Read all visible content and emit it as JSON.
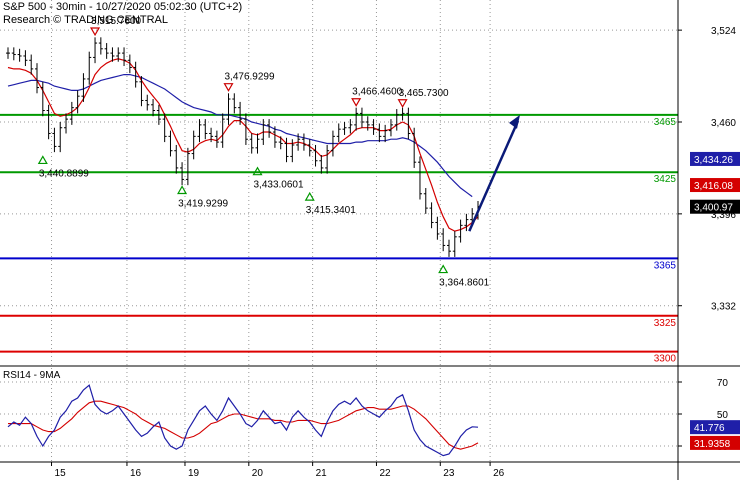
{
  "header": {
    "line1": "S&P 500 - 30min - 10/27/2020 05:02:30 (UTC+2)",
    "line2": "Research © TRADING CENTRAL"
  },
  "colors": {
    "price": "#000000",
    "ma_fast": "#d40000",
    "ma_slow": "#1f1fa8",
    "support_resistance": "#009900",
    "pivot": "#0000cc",
    "lower_levels": "#dd0000",
    "arrow": "#0a1a78",
    "grid": "#999999"
  },
  "chart_data": [
    {
      "type": "line",
      "title": "S&P 500 - 30min - 10/27/2020 05:02:30 (UTC+2)",
      "x_tick_labels": [
        "15",
        "16",
        "19",
        "20",
        "21",
        "22",
        "23",
        "26"
      ],
      "y_tick_labels": [
        "3,524",
        "3,460",
        "3,396",
        "3,332"
      ],
      "ylim": [
        3290,
        3545
      ],
      "grid": true,
      "current_price": "3,400.97",
      "indicator_values": [
        "3,434.26",
        "3,416.08"
      ],
      "indicator_values_numeric": [
        3434.26,
        3416.08
      ],
      "current_price_numeric": 3400.97,
      "price": [
        3508,
        3507,
        3506,
        3503,
        3497,
        3484,
        3468,
        3452,
        3443,
        3456,
        3462,
        3470,
        3478,
        3490,
        3505,
        3515,
        3511,
        3508,
        3506,
        3508,
        3503,
        3498,
        3488,
        3475,
        3472,
        3468,
        3462,
        3450,
        3440,
        3428,
        3420,
        3438,
        3450,
        3458,
        3452,
        3450,
        3446,
        3462,
        3476,
        3470,
        3462,
        3448,
        3442,
        3448,
        3458,
        3453,
        3446,
        3445,
        3436,
        3444,
        3448,
        3444,
        3440,
        3433,
        3428,
        3440,
        3450,
        3455,
        3456,
        3458,
        3466,
        3460,
        3458,
        3455,
        3450,
        3454,
        3458,
        3465,
        3466,
        3452,
        3432,
        3410,
        3400,
        3390,
        3382,
        3374,
        3370,
        3380,
        3388,
        3392,
        3396,
        3401
      ],
      "series": [
        {
          "name": "",
          "values": [
            3498,
            3497,
            3497,
            3496,
            3494,
            3489,
            3482,
            3474,
            3466,
            3464,
            3465,
            3467,
            3470,
            3476,
            3484,
            3493,
            3498,
            3501,
            3503,
            3504,
            3503,
            3501,
            3496,
            3489,
            3483,
            3478,
            3473,
            3465,
            3457,
            3448,
            3440,
            3439,
            3441,
            3445,
            3447,
            3448,
            3447,
            3451,
            3457,
            3461,
            3461,
            3457,
            3452,
            3451,
            3453,
            3453,
            3451,
            3449,
            3445,
            3445,
            3446,
            3445,
            3443,
            3440,
            3436,
            3437,
            3441,
            3445,
            3448,
            3451,
            3455,
            3456,
            3456,
            3456,
            3454,
            3454,
            3455,
            3458,
            3460,
            3458,
            3450,
            3438,
            3427,
            3416,
            3404,
            3394,
            3386,
            3384,
            3385,
            3387,
            3390,
            3394
          ]
        },
        {
          "name": "",
          "values": [
            3485,
            3486,
            3487,
            3488,
            3489,
            3489,
            3488,
            3487,
            3485,
            3484,
            3483,
            3482,
            3482,
            3483,
            3485,
            3487,
            3489,
            3490,
            3491,
            3492,
            3493,
            3493,
            3492,
            3491,
            3489,
            3487,
            3485,
            3483,
            3480,
            3477,
            3474,
            3472,
            3470,
            3469,
            3468,
            3467,
            3465,
            3465,
            3465,
            3464,
            3463,
            3462,
            3460,
            3459,
            3458,
            3457,
            3455,
            3454,
            3452,
            3451,
            3450,
            3449,
            3448,
            3447,
            3446,
            3445,
            3445,
            3445,
            3445,
            3445,
            3446,
            3446,
            3447,
            3447,
            3447,
            3447,
            3448,
            3448,
            3449,
            3448,
            3446,
            3443,
            3440,
            3436,
            3432,
            3427,
            3422,
            3418,
            3414,
            3411,
            3408,
            3434
          ]
        }
      ],
      "annotations": [
        {
          "label": "3,515.7600",
          "value": 3515.76,
          "x_index": 15,
          "type": "high"
        },
        {
          "label": "3,476.9299",
          "value": 3476.93,
          "x_index": 38,
          "type": "high"
        },
        {
          "label": "3,466.4600",
          "value": 3466.46,
          "x_index": 60,
          "type": "high"
        },
        {
          "label": "3,465.7300",
          "value": 3465.73,
          "x_index": 68,
          "type": "high"
        },
        {
          "label": "3,440.8899",
          "value": 3440.89,
          "x_index": 6,
          "type": "low"
        },
        {
          "label": "3,419.9299",
          "value": 3419.93,
          "x_index": 30,
          "type": "low"
        },
        {
          "label": "3,433.0601",
          "value": 3433.06,
          "x_index": 43,
          "type": "low"
        },
        {
          "label": "3,415.3401",
          "value": 3415.34,
          "x_index": 52,
          "type": "low"
        },
        {
          "label": "3,364.8601",
          "value": 3364.86,
          "x_index": 75,
          "type": "low"
        }
      ],
      "levels": [
        {
          "label": "3465",
          "value": 3465,
          "kind": "resistance"
        },
        {
          "label": "3425",
          "value": 3425,
          "kind": "resistance"
        },
        {
          "label": "3365",
          "value": 3365,
          "kind": "pivot"
        },
        {
          "label": "3325",
          "value": 3325,
          "kind": "support"
        },
        {
          "label": "3300",
          "value": 3300,
          "kind": "support"
        }
      ],
      "projection": {
        "from_index": 79,
        "to_value": 3465,
        "direction": "up"
      }
    },
    {
      "type": "line",
      "title": "RSI14 - 9MA",
      "x_tick_labels": [
        "15",
        "16",
        "19",
        "20",
        "21",
        "22",
        "23",
        "26"
      ],
      "y_tick_labels": [
        "70",
        "50",
        "30"
      ],
      "ylim": [
        20,
        80
      ],
      "grid": true,
      "current_values": [
        "41.776",
        "31.9358"
      ],
      "current_values_numeric": [
        41.776,
        31.9358
      ],
      "series": [
        {
          "name": "",
          "values": [
            42,
            45,
            43,
            48,
            44,
            36,
            30,
            36,
            40,
            48,
            52,
            58,
            60,
            65,
            68,
            56,
            52,
            50,
            52,
            55,
            50,
            45,
            40,
            36,
            38,
            42,
            45,
            35,
            30,
            28,
            30,
            40,
            46,
            52,
            55,
            50,
            46,
            52,
            60,
            55,
            50,
            44,
            42,
            46,
            52,
            48,
            44,
            45,
            40,
            48,
            52,
            48,
            45,
            40,
            36,
            45,
            52,
            56,
            58,
            56,
            60,
            55,
            52,
            50,
            48,
            52,
            55,
            60,
            62,
            52,
            40,
            34,
            30,
            28,
            26,
            24,
            25,
            30,
            36,
            40,
            42,
            41.776
          ]
        },
        {
          "name": "",
          "values": [
            44,
            44,
            44,
            44,
            44,
            42,
            40,
            39,
            39,
            41,
            44,
            47,
            51,
            54,
            57,
            58,
            58,
            57,
            56,
            55,
            54,
            52,
            50,
            47,
            45,
            43,
            42,
            41,
            39,
            37,
            35,
            35,
            36,
            38,
            41,
            44,
            45,
            47,
            49,
            50,
            50,
            49,
            48,
            47,
            47,
            47,
            46,
            46,
            45,
            45,
            46,
            46,
            46,
            45,
            44,
            44,
            45,
            46,
            48,
            50,
            52,
            53,
            54,
            54,
            53,
            53,
            53,
            54,
            55,
            55,
            53,
            50,
            47,
            43,
            39,
            35,
            31,
            29,
            28,
            29,
            30,
            31.9358
          ]
        }
      ],
      "levels": [
        70,
        50,
        30
      ]
    }
  ]
}
